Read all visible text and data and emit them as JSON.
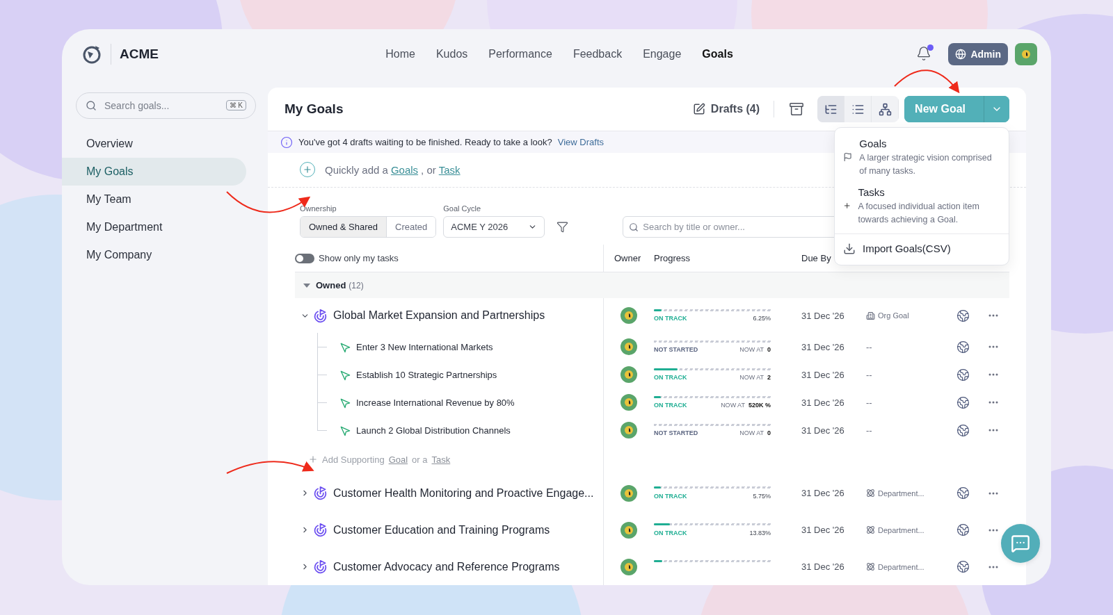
{
  "header": {
    "brand": "ACME",
    "nav": [
      {
        "label": "Home",
        "selected": false
      },
      {
        "label": "Kudos",
        "selected": false
      },
      {
        "label": "Performance",
        "selected": false
      },
      {
        "label": "Feedback",
        "selected": false
      },
      {
        "label": "Engage",
        "selected": false
      },
      {
        "label": "Goals",
        "selected": true
      }
    ],
    "notifications": {
      "unread": true
    },
    "admin": "Admin"
  },
  "sidebar": {
    "search": {
      "placeholder": "Search goals...",
      "shortcut": "⌘ K"
    },
    "items": [
      {
        "label": "Overview",
        "selected": false
      },
      {
        "label": "My Goals",
        "selected": true
      },
      {
        "label": "My Team",
        "selected": false
      },
      {
        "label": "My Department",
        "selected": false
      },
      {
        "label": "My Company",
        "selected": false
      }
    ]
  },
  "card": {
    "title": "My Goals",
    "drafts": "Drafts (4)",
    "views": [
      {
        "kind": "tree",
        "selected": true
      },
      {
        "kind": "list",
        "selected": false
      },
      {
        "kind": "org",
        "selected": false
      }
    ],
    "new_goal": "New Goal",
    "menu": [
      {
        "kind": "goal",
        "title": "Goals",
        "description": "A larger strategic vision comprised of many tasks."
      },
      {
        "kind": "task",
        "title": "Tasks",
        "description": "A focused individual action item towards achieving a Goal."
      },
      {
        "kind": "import",
        "title": "Import Goals(CSV)"
      }
    ],
    "banner": {
      "text": "You've got 4 drafts waiting to be finished. Ready to take a look?",
      "link": "View Drafts"
    },
    "quick_add": {
      "text": "Quickly add a",
      "goal_link": "Goals",
      "separator": ", or",
      "task_link": "Task"
    },
    "filters": {
      "ownership_label": "Ownership",
      "ownership": [
        {
          "label": "Owned & Shared",
          "selected": true
        },
        {
          "label": "Created",
          "selected": false
        }
      ],
      "cycle_label": "Goal Cycle",
      "cycle": "ACME Y 2026",
      "search_placeholder": "Search by title or owner..."
    },
    "toggle": {
      "label": "Show only my tasks",
      "on": false
    },
    "columns": [
      "Owner",
      "Progress",
      "Due By"
    ],
    "group": {
      "name": "Owned",
      "count": "(12)",
      "expanded": true
    },
    "goals": [
      {
        "title": "Global Market Expansion and Partnerships",
        "expanded": true,
        "status": {
          "kind": "on_track",
          "label": "ON TRACK"
        },
        "level": 0.0625,
        "reading": "6.25%",
        "due": "31 Dec '26",
        "type": {
          "kind": "org",
          "label": "Org Goal"
        },
        "children": [
          {
            "title": "Enter 3 New International Markets",
            "status": {
              "kind": "not_started",
              "label": "NOT STARTED"
            },
            "reading_label": "NOW AT",
            "reading": "0",
            "due": "31 Dec '26",
            "type": "--"
          },
          {
            "title": "Establish 10 Strategic Partnerships",
            "status": {
              "kind": "on_track",
              "label": "ON TRACK"
            },
            "level": 0.2,
            "reading_label": "NOW AT",
            "reading": "2",
            "due": "31 Dec '26",
            "type": "--"
          },
          {
            "title": "Increase International Revenue by 80%",
            "status": {
              "kind": "on_track",
              "label": "ON TRACK"
            },
            "level": 0.06,
            "reading_label": "NOW AT",
            "reading": "520K %",
            "due": "31 Dec '26",
            "type": "--"
          },
          {
            "title": "Launch 2 Global Distribution Channels",
            "status": {
              "kind": "not_started",
              "label": "NOT STARTED"
            },
            "reading_label": "NOW AT",
            "reading": "0",
            "due": "31 Dec '26",
            "type": "--"
          }
        ],
        "add_supporting": {
          "text": "Add Supporting",
          "goal_link": "Goal",
          "separator": "or a",
          "task_link": "Task"
        }
      },
      {
        "title": "Customer Health Monitoring and Proactive Engage...",
        "expanded": false,
        "status": {
          "kind": "on_track",
          "label": "ON TRACK"
        },
        "level": 0.0575,
        "reading": "5.75%",
        "due": "31 Dec '26",
        "type": {
          "kind": "department",
          "label": "Department..."
        }
      },
      {
        "title": "Customer Education and Training Programs",
        "expanded": false,
        "status": {
          "kind": "on_track",
          "label": "ON TRACK"
        },
        "level": 0.1383,
        "reading": "13.83%",
        "due": "31 Dec '26",
        "type": {
          "kind": "department",
          "label": "Department..."
        }
      },
      {
        "title": "Customer Advocacy and Reference Programs",
        "expanded": false,
        "level": 0.07,
        "due": "31 Dec '26",
        "type": {
          "kind": "department",
          "label": "Department..."
        }
      }
    ]
  }
}
